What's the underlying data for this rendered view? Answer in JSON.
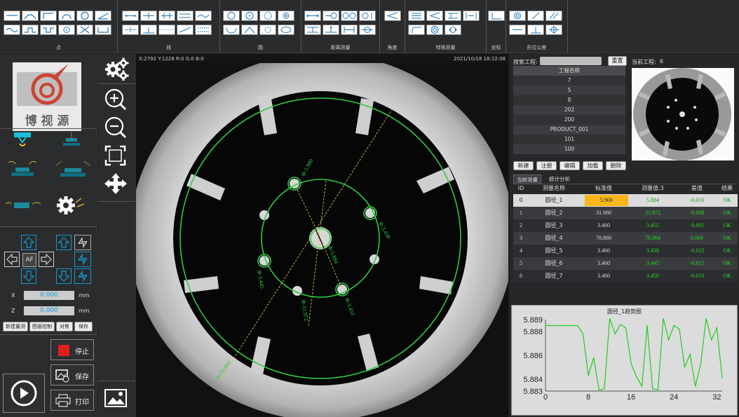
{
  "ribbon": {
    "groups": [
      {
        "label": "点"
      },
      {
        "label": "线"
      },
      {
        "label": "圆"
      },
      {
        "label": "距离测量"
      },
      {
        "label": "角度"
      },
      {
        "label": "特殊测量"
      },
      {
        "label": "坐标"
      },
      {
        "label": "形位公差"
      }
    ]
  },
  "logo": {
    "text": "博 视 源"
  },
  "axes": {
    "x_label": "X",
    "x_value": "0.000",
    "x_unit": "mm",
    "z_label": "Z",
    "z_value": "0.000",
    "z_unit": "mm",
    "af_label": "AF"
  },
  "left_buttons": [
    "新建量测",
    "图层控制",
    "对焦",
    "保存"
  ],
  "actions": {
    "stop": "停止",
    "save": "保存",
    "print": "打印"
  },
  "image": {
    "coords": "X:2792  Y:1228  R:0  G:0  B:0",
    "datetime": "2021/10/18    18:22:08",
    "labels": [
      "Φ-5.900",
      "Φ-3.438",
      "Φ-5.884",
      "Φ-3.445",
      "Φ-31.972",
      "Φ-3.455",
      "Φ-78.860"
    ]
  },
  "search": {
    "label": "搜索工程:",
    "value": "",
    "reset": "重置",
    "current_label": "当前工程:",
    "current_value": "6"
  },
  "projects": {
    "header": "工程名称",
    "items": [
      "7",
      "5",
      "8",
      "202",
      "200",
      "PRODUCT_001",
      "101",
      "100"
    ]
  },
  "project_buttons": [
    "新建",
    "注册",
    "编辑",
    "加载",
    "删除"
  ],
  "tabs": [
    "当前测量",
    "统计分析"
  ],
  "table": {
    "headers": [
      "ID",
      "测量名称",
      "标准值",
      "测量值:3",
      "差值",
      "结果"
    ],
    "rows": [
      [
        "0",
        "圆径_1",
        "5.900",
        "5.884",
        "-0.016",
        "OK"
      ],
      [
        "1",
        "圆径_2",
        "31.980",
        "31.972",
        "-0.008",
        "OK"
      ],
      [
        "2",
        "圆径_3",
        "3.460",
        "3.455",
        "-0.005",
        "OK"
      ],
      [
        "3",
        "圆径_4",
        "78.860",
        "78.864",
        "0.004",
        "OK"
      ],
      [
        "4",
        "圆径_5",
        "3.460",
        "3.438",
        "-0.022",
        "OK"
      ],
      [
        "5",
        "圆径_6",
        "3.460",
        "3.445",
        "-0.015",
        "OK"
      ],
      [
        "6",
        "圆径_7",
        "3.460",
        "3.450",
        "-0.010",
        "OK"
      ]
    ]
  },
  "chart_data": {
    "type": "line",
    "title": "圆径_1趋势图",
    "xlabel": "",
    "ylabel": "",
    "xlim": [
      0,
      33
    ],
    "ylim": [
      5.883,
      5.889
    ],
    "x_ticks": [
      "0",
      "8",
      "16",
      "24",
      "32"
    ],
    "y_ticks": [
      "5.889",
      "5.888",
      "5.886",
      "5.884",
      "5.883"
    ],
    "color": "#22cc22",
    "x": [
      0,
      1,
      2,
      3,
      4,
      5,
      6,
      7,
      8,
      9,
      10,
      11,
      12,
      13,
      14,
      15,
      16,
      17,
      18,
      19,
      20,
      21,
      22,
      23,
      24,
      25,
      26,
      27,
      28,
      29,
      30,
      31,
      32,
      33
    ],
    "values": [
      5.8885,
      5.8885,
      5.8885,
      5.8885,
      5.8885,
      5.8885,
      5.8885,
      5.8878,
      5.8843,
      5.8858,
      5.8831,
      5.8832,
      5.8891,
      5.8878,
      5.8886,
      5.8883,
      5.8853,
      5.8842,
      5.8834,
      5.8885,
      5.8832,
      5.8831,
      5.8891,
      5.8873,
      5.8885,
      5.8882,
      5.885,
      5.8861,
      5.8834,
      5.8853,
      5.8891,
      5.8873,
      5.8883,
      5.8841
    ]
  }
}
